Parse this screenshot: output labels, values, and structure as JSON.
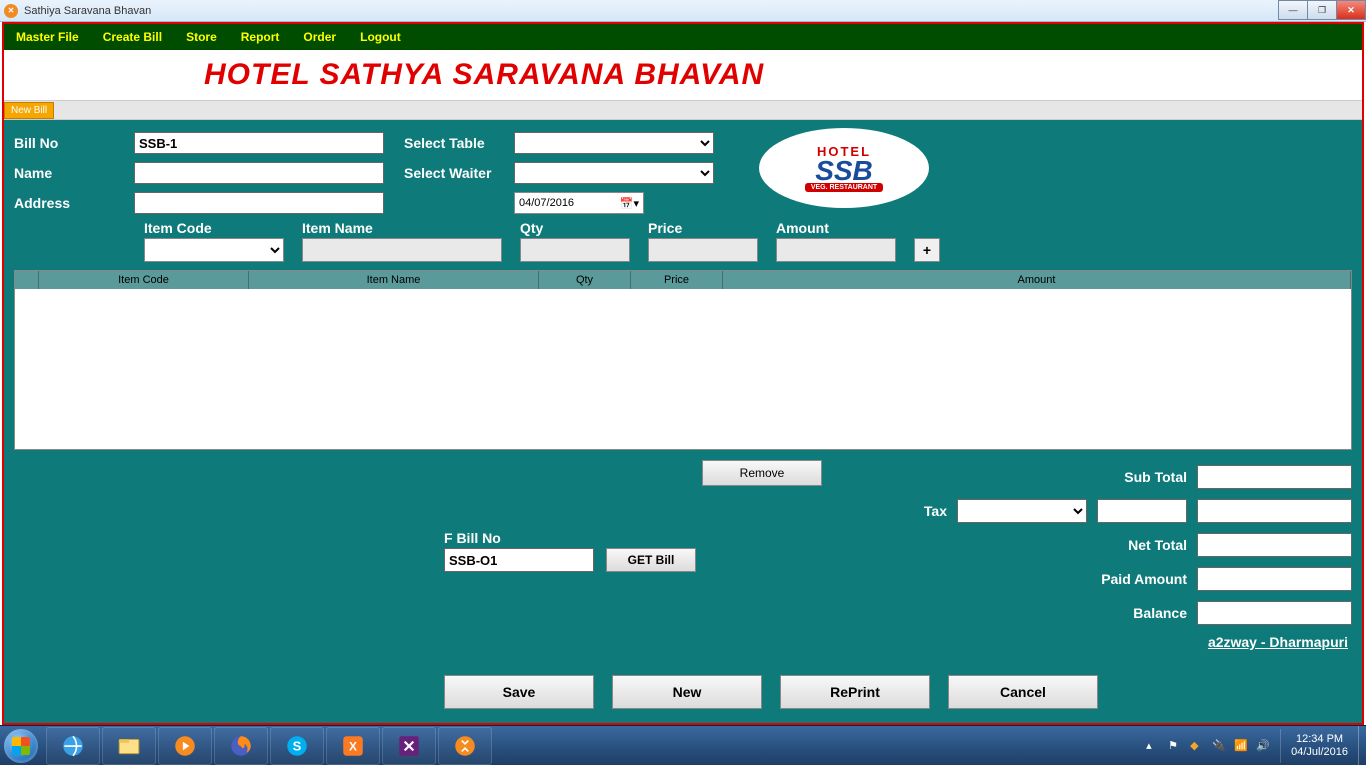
{
  "window": {
    "title": "Sathiya Saravana Bhavan"
  },
  "menu": {
    "master_file": "Master File",
    "create_bill": "Create Bill",
    "store": "Store",
    "report": "Report",
    "order": "Order",
    "logout": "Logout"
  },
  "header": {
    "title": "HOTEL SATHYA SARAVANA BHAVAN"
  },
  "tab": {
    "new_bill": "New Bill"
  },
  "form": {
    "bill_no_label": "Bill No",
    "bill_no_value": "SSB-1",
    "name_label": "Name",
    "name_value": "",
    "address_label": "Address",
    "address_value": "",
    "select_table_label": "Select Table",
    "select_waiter_label": "Select Waiter",
    "date_value": "04/07/2016"
  },
  "logo": {
    "top": "HOTEL",
    "mid": "SSB",
    "bot": "VEG. RESTAURANT"
  },
  "entry": {
    "item_code": "Item Code",
    "item_name": "Item Name",
    "qty": "Qty",
    "price": "Price",
    "amount": "Amount",
    "add": "+"
  },
  "grid": {
    "headers": {
      "item_code": "Item Code",
      "item_name": "Item Name",
      "qty": "Qty",
      "price": "Price",
      "amount": "Amount"
    }
  },
  "actions": {
    "remove": "Remove",
    "fbill_label": "F Bill No",
    "fbill_value": "SSB-O1",
    "get_bill": "GET Bill",
    "save": "Save",
    "new": "New",
    "reprint": "RePrint",
    "cancel": "Cancel"
  },
  "totals": {
    "sub_total": "Sub Total",
    "tax": "Tax",
    "net_total": "Net Total",
    "paid_amount": "Paid Amount",
    "balance": "Balance"
  },
  "footer": {
    "link": "a2zway - Dharmapuri"
  },
  "systray": {
    "time": "12:34 PM",
    "date": "04/Jul/2016"
  }
}
